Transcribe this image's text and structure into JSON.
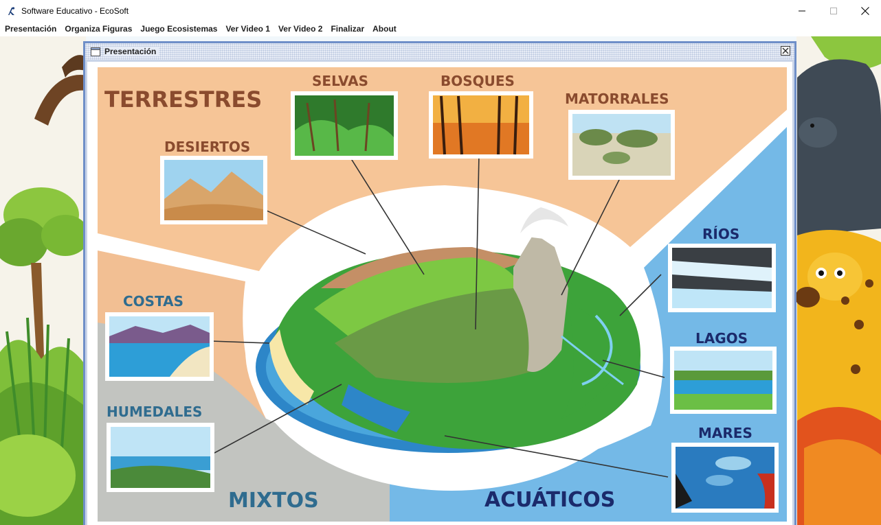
{
  "window": {
    "title": "Software Educativo - EcoSoft"
  },
  "menu": [
    {
      "label": "Presentación"
    },
    {
      "label": "Organiza Figuras"
    },
    {
      "label": "Juego Ecosistemas"
    },
    {
      "label": "Ver Video 1"
    },
    {
      "label": "Ver Video 2"
    },
    {
      "label": "Finalizar"
    },
    {
      "label": "About"
    }
  ],
  "internal_frame": {
    "title": "Presentación"
  },
  "infographic": {
    "groups": {
      "terrestres": "TERRESTRES",
      "mixtos": "MIXTOS",
      "acuaticos": "ACUÁTICOS"
    },
    "ecosystems": {
      "selvas": "SELVAS",
      "bosques": "BOSQUES",
      "matorrales": "MATORRALES",
      "desiertos": "DESIERTOS",
      "costas": "COSTAS",
      "humedales": "HUMEDALES",
      "rios": "RÍOS",
      "lagos": "LAGOS",
      "mares": "MARES"
    }
  },
  "colors": {
    "terrestres": "#f6c597",
    "acuaticos": "#74b9e7",
    "title_brown": "#8a4b2e",
    "title_navy": "#1b2a6b",
    "title_teal": "#2f6c8f",
    "frame_border": "#6f8fc8"
  }
}
